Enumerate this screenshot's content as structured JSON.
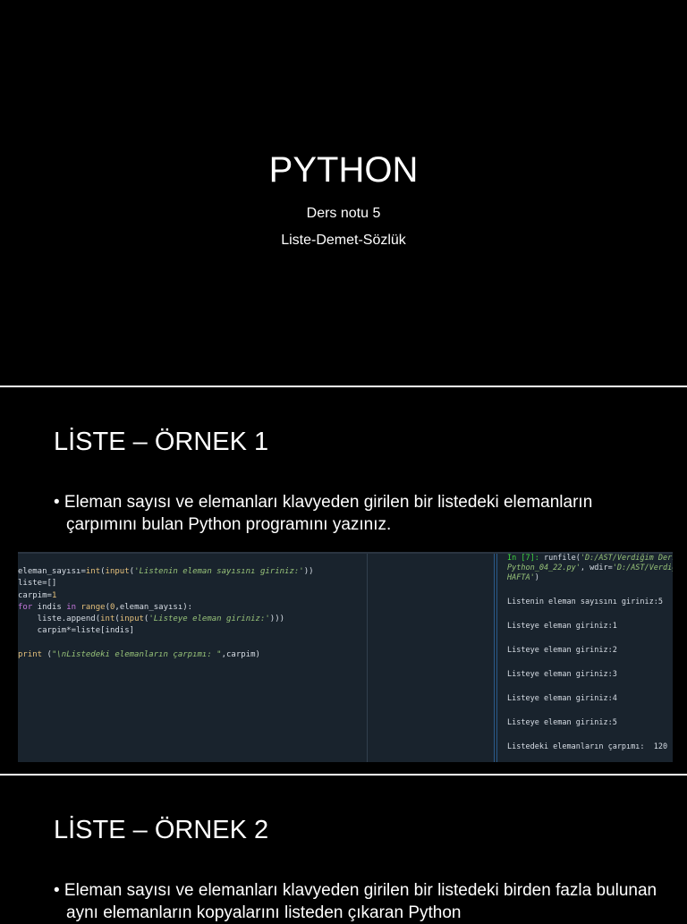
{
  "slide1": {
    "title": "PYTHON",
    "subtitle1": "Ders notu 5",
    "subtitle2": "Liste-Demet-Sözlük"
  },
  "slide2": {
    "heading": "LİSTE – ÖRNEK 1",
    "bullet": "• Eleman sayısı ve elemanları klavyeden girilen bir listedeki elemanların çarpımını bulan Python programını yazınız.",
    "code": {
      "l1a": "eleman_sayısı=",
      "l1b": "int",
      "l1c": "(",
      "l1d": "input",
      "l1e": "(",
      "l1f": "'Listenin eleman sayısını giriniz:'",
      "l1g": "))",
      "l2": "liste=[]",
      "l3a": "carpim=",
      "l3b": "1",
      "l4a": "for",
      "l4b": " indis ",
      "l4c": "in",
      "l4d": " ",
      "l4e": "range",
      "l4f": "(",
      "l4g": "0",
      "l4h": ",eleman_sayısı):",
      "l5a": "    liste.append(",
      "l5b": "int",
      "l5c": "(",
      "l5d": "input",
      "l5e": "(",
      "l5f": "'Listeye eleman giriniz:'",
      "l5g": ")))",
      "l6": "    carpim*=liste[indis]",
      "l8a": "print",
      "l8b": " (",
      "l8c": "\"\\nListedeki elemanların çarpımı: \"",
      "l8d": ",carpim)"
    },
    "console": {
      "prompt": "In [7]:",
      "run1": " runfile(",
      "run2": "'D:/AST/Verdiğim Ders",
      "run3": "Python_04_22.py'",
      "run4": ", wdir=",
      "run5": "'D:/AST/Verdiğ",
      "run6": "HAFTA'",
      "run7": ")",
      "lines": [
        "Listenin eleman sayısını giriniz:5",
        "Listeye eleman giriniz:1",
        "Listeye eleman giriniz:2",
        "Listeye eleman giriniz:3",
        "Listeye eleman giriniz:4",
        "Listeye eleman giriniz:5",
        "Listedeki elemanların çarpımı:  120"
      ]
    }
  },
  "slide3": {
    "heading": "LİSTE – ÖRNEK 2",
    "bullet": "• Eleman sayısı ve elemanları klavyeden girilen bir listedeki birden fazla bulunan aynı elemanların kopyalarını listeden çıkaran Python"
  }
}
